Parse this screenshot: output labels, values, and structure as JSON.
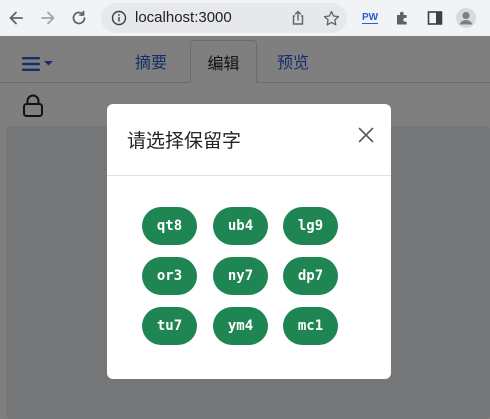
{
  "browser": {
    "url": "localhost:3000",
    "profile_ext_label": "PW",
    "icons": [
      "back-arrow-icon",
      "forward-arrow-icon",
      "reload-icon",
      "info-icon",
      "share-icon",
      "star-icon",
      "puzzle-icon",
      "sidebar-icon",
      "profile-icon"
    ]
  },
  "page": {
    "tabs": [
      {
        "label": "摘要",
        "active": false
      },
      {
        "label": "编辑",
        "active": true
      },
      {
        "label": "预览",
        "active": false
      }
    ],
    "link_color": "#2a5bd7"
  },
  "modal": {
    "title": "请选择保留字",
    "words": [
      "qt8",
      "ub4",
      "lg9",
      "or3",
      "ny7",
      "dp7",
      "tu7",
      "ym4",
      "mc1"
    ],
    "word_color": "#1e8553"
  }
}
